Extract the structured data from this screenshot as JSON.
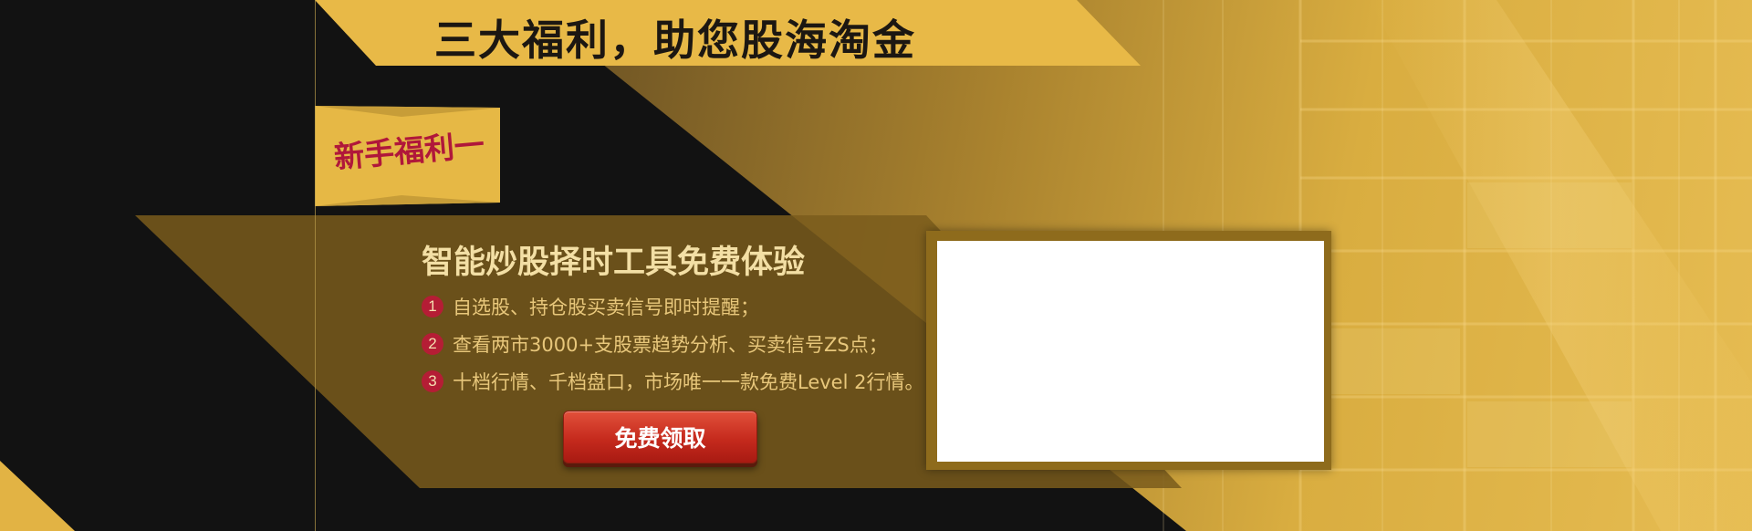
{
  "banner": {
    "headline": "三大福利，助您股海淘金",
    "tag_label": "新手福利一",
    "feature_title": "智能炒股择时工具免费体验",
    "features": [
      {
        "number": "1",
        "text": "自选股、持仓股买卖信号即时提醒；"
      },
      {
        "number": "2",
        "text": "查看两市3000+支股票趋势分析、买卖信号ZS点；"
      },
      {
        "number": "3",
        "text": "十档行情、千档盘口，市场唯一一款免费Level 2行情。"
      }
    ],
    "cta_label": "免费领取"
  },
  "colors": {
    "gold": "#e8b947",
    "dark": "#121212",
    "badge_red": "#b51d35",
    "button_red": "#c52a1d",
    "feature_text": "#e8c77b"
  }
}
